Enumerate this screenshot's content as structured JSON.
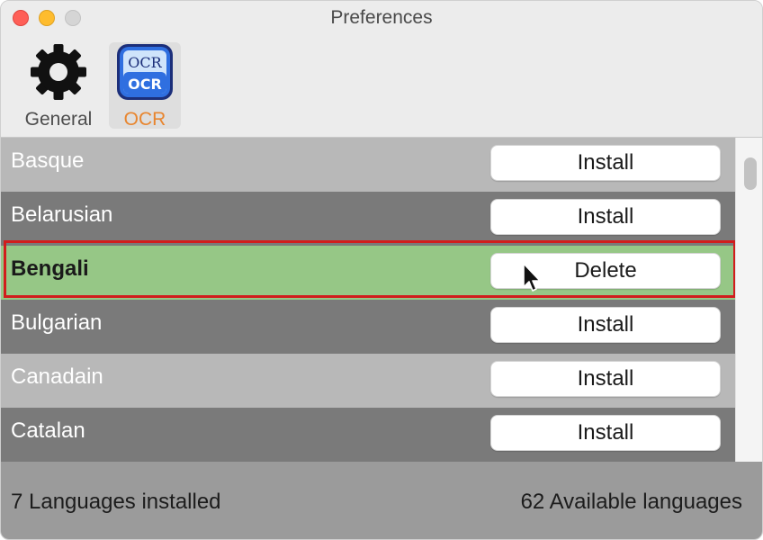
{
  "window": {
    "title": "Preferences"
  },
  "toolbar": {
    "items": [
      {
        "label": "General",
        "icon": "gear-icon"
      },
      {
        "label": "OCR",
        "icon": "ocr-icon",
        "selected": true,
        "icon_text_top": "OCR",
        "icon_text_bottom": "OCR"
      }
    ]
  },
  "languages": [
    {
      "name": "Basque",
      "action": "Install",
      "shade": "light"
    },
    {
      "name": "Belarusian",
      "action": "Install",
      "shade": "dark"
    },
    {
      "name": "Bengali",
      "action": "Delete",
      "shade": "selected"
    },
    {
      "name": "Bulgarian",
      "action": "Install",
      "shade": "dark"
    },
    {
      "name": "Canadain",
      "action": "Install",
      "shade": "light"
    },
    {
      "name": "Catalan",
      "action": "Install",
      "shade": "dark"
    }
  ],
  "footer": {
    "installed": "7 Languages installed",
    "available": "62 Available languages"
  },
  "colors": {
    "selected_row": "#96c786",
    "highlight_border": "#d11d1d",
    "ocr_label": "#e8852e",
    "light_row": "#b8b8b8",
    "dark_row": "#7a7a7a"
  }
}
